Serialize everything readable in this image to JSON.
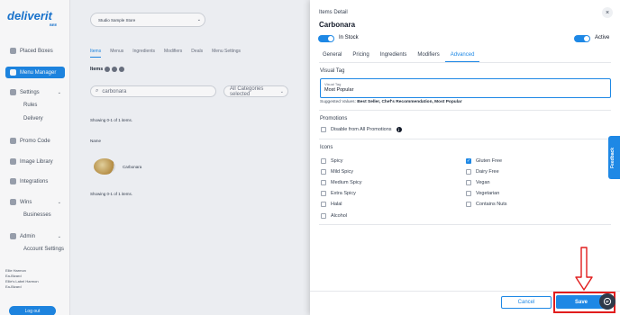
{
  "background": {
    "logo": "deliverit",
    "logo_sub": "BEE",
    "nav": [
      {
        "label": "Placed Boxes"
      },
      {
        "label": "Menu Manager"
      },
      {
        "label": "Settings"
      },
      {
        "label": "Rules"
      },
      {
        "label": "Delivery"
      },
      {
        "label": "Promo Code"
      },
      {
        "label": "Image Library"
      },
      {
        "label": "Integrations"
      },
      {
        "label": "Wins"
      },
      {
        "label": "Businesses"
      },
      {
        "label": "Admin"
      },
      {
        "label": "Account Settings"
      }
    ],
    "footer_lines": [
      "Ellie Harmon",
      "Ea-Bizard",
      "Ellie's Label Harmon",
      "Ea-Bizard"
    ],
    "footer_button": "Log out",
    "store_select": "Studio Sample Store",
    "tabs": [
      "Items",
      "Menus",
      "Ingredients",
      "Modifiers",
      "Deals",
      "Menu Settings"
    ],
    "items_heading": "Items",
    "search_value": "carbonara",
    "category_placeholder": "All Categories selected",
    "showing_text": "Showing 0-1 of 1 items.",
    "name_header": "Name",
    "row_item": "Carbonara",
    "showing_text_2": "Showing 0-1 of 1 items."
  },
  "drawer": {
    "title": "Items Detail",
    "item_name": "Carbonara",
    "in_stock_label": "In Stock",
    "active_label": "Active",
    "tabs": [
      {
        "label": "General"
      },
      {
        "label": "Pricing"
      },
      {
        "label": "Ingredients"
      },
      {
        "label": "Modifiers"
      },
      {
        "label": "Advanced"
      }
    ],
    "visual_tag": {
      "heading": "Visual Tag",
      "field_label": "Visual Tag",
      "value": "Most Popular",
      "suggested_prefix": "Suggested Values:",
      "suggested_values": "Best Seller, Chef's Recommendation, Most Popular"
    },
    "promotions": {
      "heading": "Promotions",
      "disable_label": "Disable from All Promotions"
    },
    "icons": {
      "heading": "Icons",
      "left": [
        {
          "label": "Spicy",
          "checked": false
        },
        {
          "label": "Mild Spicy",
          "checked": false
        },
        {
          "label": "Medium Spicy",
          "checked": false
        },
        {
          "label": "Extra Spicy",
          "checked": false
        },
        {
          "label": "Halal",
          "checked": false
        },
        {
          "label": "Alcohol",
          "checked": false
        }
      ],
      "right": [
        {
          "label": "Gluten Free",
          "checked": true
        },
        {
          "label": "Dairy Free",
          "checked": false
        },
        {
          "label": "Vegan",
          "checked": false
        },
        {
          "label": "Vegetarian",
          "checked": false
        },
        {
          "label": "Contains Nuts",
          "checked": false
        }
      ]
    },
    "cancel_label": "Cancel",
    "save_label": "Save"
  },
  "feedback_label": "Feedback",
  "colors": {
    "accent": "#1e88e5",
    "highlight": "#e11d1d"
  }
}
